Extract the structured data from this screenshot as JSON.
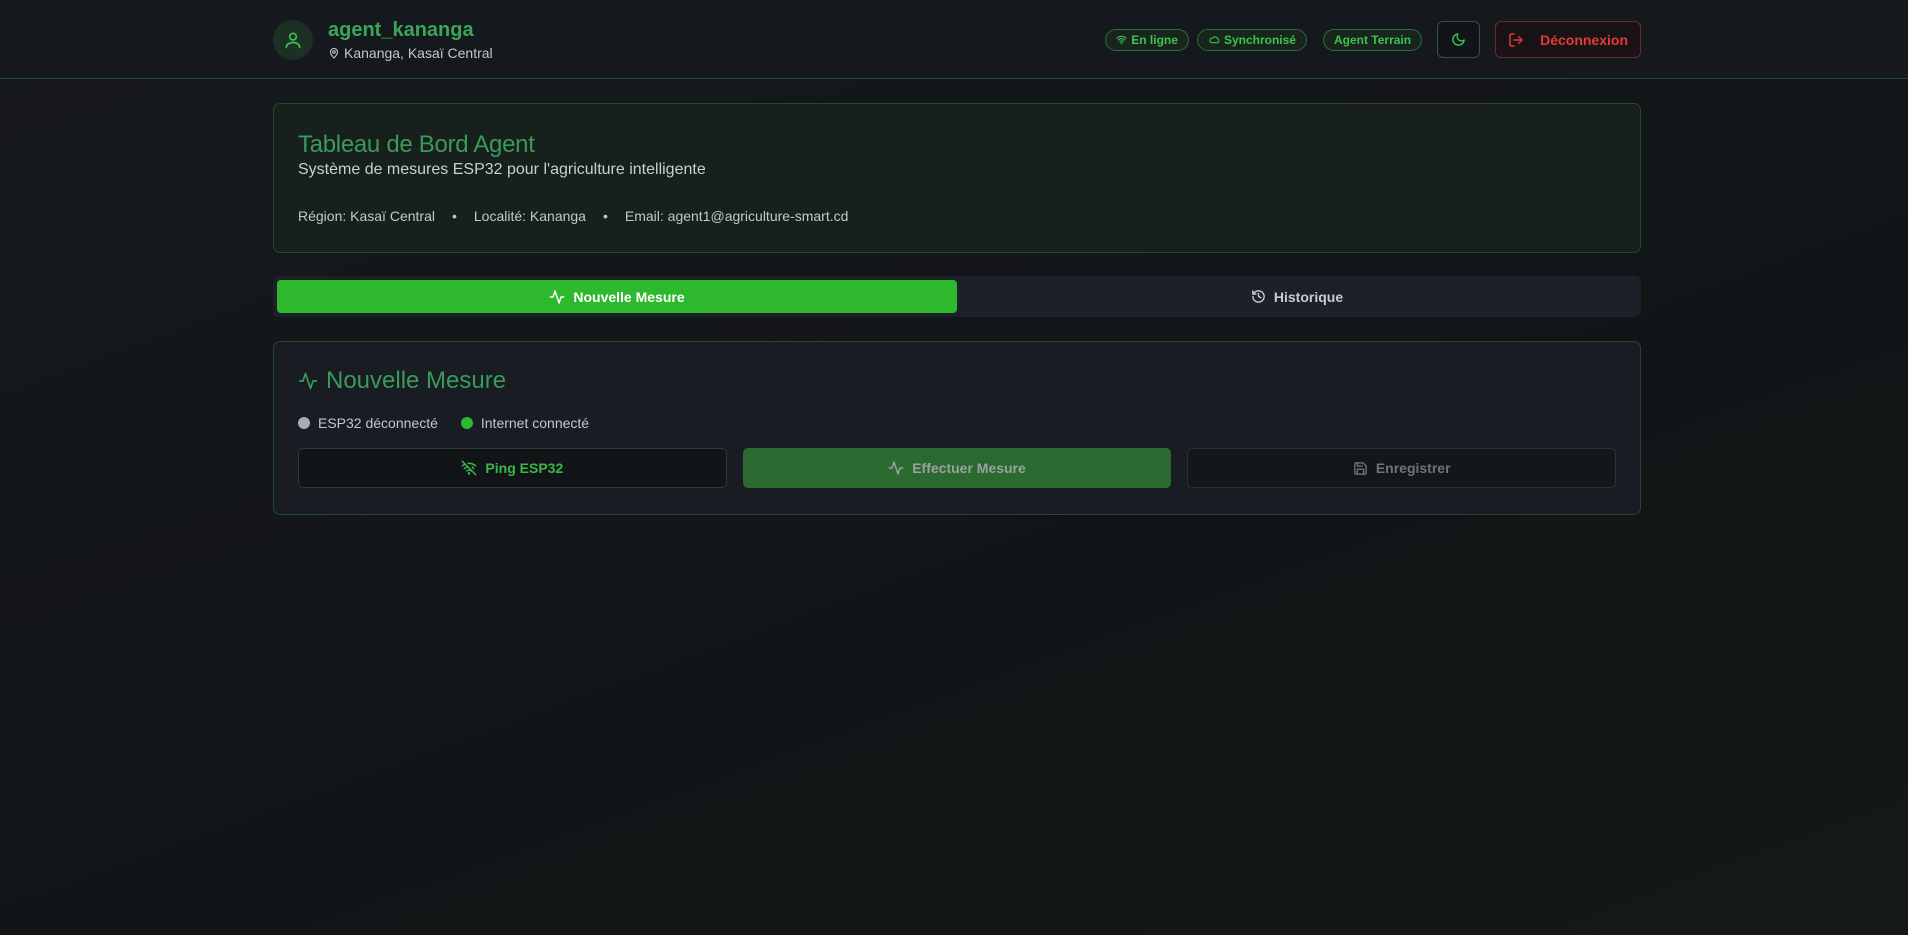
{
  "header": {
    "username": "agent_kananga",
    "location": "Kananga, Kasaï Central",
    "badges": {
      "online": "En ligne",
      "synced": "Synchronisé",
      "role": "Agent Terrain"
    },
    "logout_label": "Déconnexion"
  },
  "welcome": {
    "title": "Tableau de Bord Agent",
    "subtitle": "Système de mesures ESP32 pour l'agriculture intelligente",
    "region": "Région: Kasaï Central",
    "locality": "Localité: Kananga",
    "email": "Email: agent1@agriculture-smart.cd",
    "separator": "•"
  },
  "tabs": {
    "new_measure": "Nouvelle Mesure",
    "history": "Historique"
  },
  "measure_card": {
    "title": "Nouvelle Mesure",
    "esp32_status": "ESP32 déconnecté",
    "internet_status": "Internet connecté",
    "ping_label": "Ping ESP32",
    "measure_label": "Effectuer Mesure",
    "save_label": "Enregistrer"
  },
  "colors": {
    "accent": "#2db82e",
    "brand_text": "#3a9a5a",
    "danger": "#e23a3a",
    "esp32_disconnected": "#a7adb5",
    "internet_connected": "#2db82e"
  },
  "icons": {
    "avatar": "user-icon",
    "location": "map-pin-icon",
    "online": "wifi-icon",
    "synced": "cloud-icon",
    "theme": "moon-icon",
    "logout": "log-out-icon",
    "new_measure": "activity-icon",
    "history": "history-icon",
    "ping": "wifi-off-icon",
    "save": "save-icon"
  }
}
